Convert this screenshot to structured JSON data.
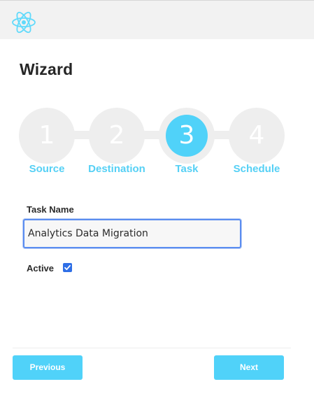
{
  "header": {
    "logo_icon": "react-atom-icon",
    "logo_color": "#61dafb"
  },
  "wizard": {
    "title": "Wizard",
    "current_step": 3,
    "accent_color": "#50d2f9",
    "steps": [
      {
        "number": "1",
        "label": "Source"
      },
      {
        "number": "2",
        "label": "Destination"
      },
      {
        "number": "3",
        "label": "Task"
      },
      {
        "number": "4",
        "label": "Schedule"
      }
    ]
  },
  "form": {
    "task_name_label": "Task Name",
    "task_name_value": "Analytics Data Migration",
    "active_label": "Active",
    "active_checked": true
  },
  "footer": {
    "previous_label": "Previous",
    "next_label": "Next"
  }
}
